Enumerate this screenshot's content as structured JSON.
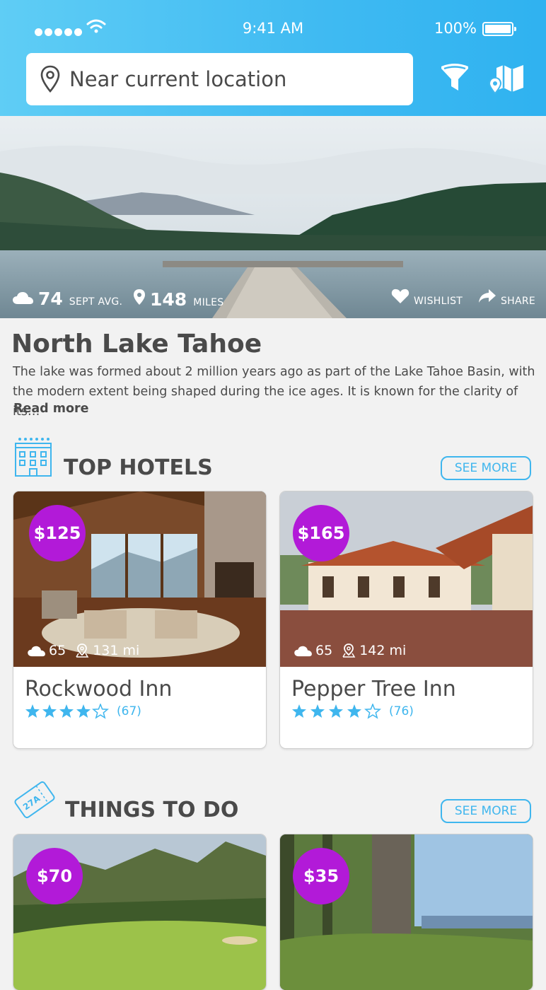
{
  "status_bar": {
    "time": "9:41 AM",
    "battery": "100%"
  },
  "search": {
    "value": "Near current location"
  },
  "hero": {
    "temp": "74",
    "temp_label": "SEPT AVG.",
    "distance": "148",
    "distance_label": "MILES",
    "wishlist": "WISHLIST",
    "share": "SHARE"
  },
  "destination": {
    "title": "North Lake Tahoe",
    "description": "The lake was formed about 2 million years ago as part of the Lake Tahoe Basin, with the modern extent being shaped during the ice ages. It is known for the clarity of its…",
    "read_more": "Read more"
  },
  "hotels": {
    "title": "TOP HOTELS",
    "see_more": "SEE MORE",
    "items": [
      {
        "price": "$125",
        "temp": "65",
        "distance": "131 mi",
        "name": "Rockwood Inn",
        "stars": 4,
        "reviews": "(67)"
      },
      {
        "price": "$165",
        "temp": "65",
        "distance": "142 mi",
        "name": "Pepper Tree Inn",
        "stars": 4.5,
        "reviews": "(76)"
      }
    ]
  },
  "things": {
    "title": "THINGS TO DO",
    "see_more": "SEE MORE",
    "badge": "27A",
    "items": [
      {
        "price": "$70"
      },
      {
        "price": "$35"
      }
    ]
  },
  "colors": {
    "accent": "#3fb6ee",
    "price_badge": "#b21ad8",
    "header_start": "#5fcdf5",
    "header_end": "#2fb2f0"
  }
}
